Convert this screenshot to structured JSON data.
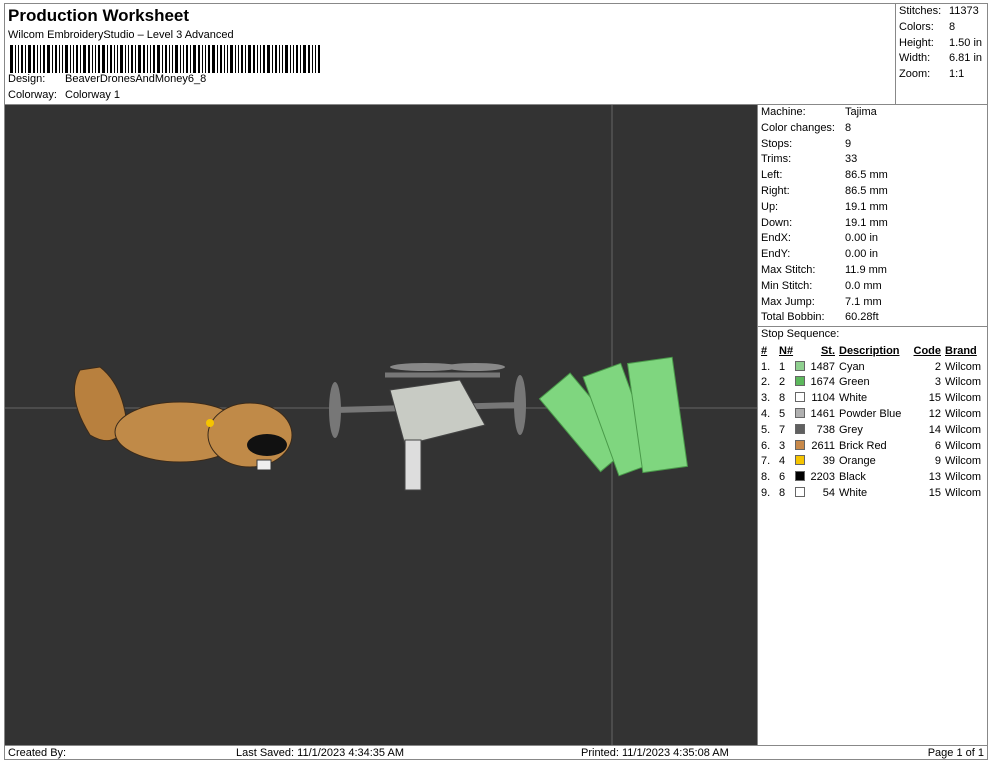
{
  "header": {
    "title": "Production Worksheet",
    "subtitle": "Wilcom EmbroideryStudio – Level 3 Advanced",
    "design_label": "Design:",
    "design_value": "BeaverDronesAndMoney6_8",
    "colorway_label": "Colorway:",
    "colorway_value": "Colorway 1"
  },
  "stats": [
    {
      "label": "Stitches:",
      "value": "11373"
    },
    {
      "label": "Colors:",
      "value": "8"
    },
    {
      "label": "Height:",
      "value": "1.50 in"
    },
    {
      "label": "Width:",
      "value": "6.81 in"
    },
    {
      "label": "Zoom:",
      "value": "1:1"
    }
  ],
  "info": [
    {
      "label": "Machine:",
      "value": "Tajima"
    },
    {
      "label": "Color changes:",
      "value": "8"
    },
    {
      "label": "Stops:",
      "value": "9"
    },
    {
      "label": "Trims:",
      "value": "33"
    },
    {
      "label": "Left:",
      "value": "86.5 mm"
    },
    {
      "label": "Right:",
      "value": "86.5 mm"
    },
    {
      "label": "Up:",
      "value": "19.1 mm"
    },
    {
      "label": "Down:",
      "value": "19.1 mm"
    },
    {
      "label": "EndX:",
      "value": "0.00 in"
    },
    {
      "label": "EndY:",
      "value": "0.00 in"
    },
    {
      "label": "Max Stitch:",
      "value": "11.9 mm"
    },
    {
      "label": "Min Stitch:",
      "value": "0.0 mm"
    },
    {
      "label": "Max Jump:",
      "value": "7.1 mm"
    },
    {
      "label": "Total Bobbin:",
      "value": "60.28ft"
    }
  ],
  "stop_sequence": {
    "title": "Stop Sequence:",
    "headers": [
      "#",
      "N#",
      "St.",
      "Description",
      "Code",
      "Brand"
    ],
    "rows": [
      {
        "idx": "1.",
        "n": "1",
        "color": "#8fd08f",
        "st": "1487",
        "desc": "Cyan",
        "code": "2",
        "brand": "Wilcom"
      },
      {
        "idx": "2.",
        "n": "2",
        "color": "#5cb85c",
        "st": "1674",
        "desc": "Green",
        "code": "3",
        "brand": "Wilcom"
      },
      {
        "idx": "3.",
        "n": "8",
        "color": "#ffffff",
        "st": "1104",
        "desc": "White",
        "code": "15",
        "brand": "Wilcom"
      },
      {
        "idx": "4.",
        "n": "5",
        "color": "#b0b0b0",
        "st": "1461",
        "desc": "Powder Blue",
        "code": "12",
        "brand": "Wilcom"
      },
      {
        "idx": "5.",
        "n": "7",
        "color": "#606060",
        "st": "738",
        "desc": "Grey",
        "code": "14",
        "brand": "Wilcom"
      },
      {
        "idx": "6.",
        "n": "3",
        "color": "#c8894a",
        "st": "2611",
        "desc": "Brick Red",
        "code": "6",
        "brand": "Wilcom"
      },
      {
        "idx": "7.",
        "n": "4",
        "color": "#f5c400",
        "st": "39",
        "desc": "Orange",
        "code": "9",
        "brand": "Wilcom"
      },
      {
        "idx": "8.",
        "n": "6",
        "color": "#000000",
        "st": "2203",
        "desc": "Black",
        "code": "13",
        "brand": "Wilcom"
      },
      {
        "idx": "9.",
        "n": "8",
        "color": "#ffffff",
        "st": "54",
        "desc": "White",
        "code": "15",
        "brand": "Wilcom"
      }
    ]
  },
  "footer": {
    "created": "Created By:",
    "saved": "Last Saved: 11/1/2023 4:34:35 AM",
    "printed": "Printed: 11/1/2023 4:35:08 AM",
    "page": "Page 1 of 1"
  }
}
